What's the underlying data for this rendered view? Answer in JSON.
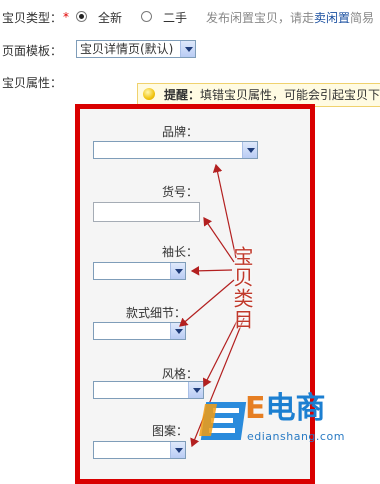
{
  "form": {
    "item_type": {
      "label": "宝贝类型：",
      "required_mark": "*",
      "options": [
        {
          "label": "全新",
          "checked": true
        },
        {
          "label": "二手",
          "checked": false
        }
      ],
      "hint_prefix": "发布闲置宝贝，请走",
      "hint_link": "卖闲置",
      "hint_suffix": "简易"
    },
    "page_template": {
      "label": "页面模板：",
      "selected": "宝贝详情页(默认)"
    },
    "attributes": {
      "label": "宝贝属性：",
      "notice_title": "提醒：",
      "notice_text": "填错宝贝属性，可能会引起宝贝下"
    }
  },
  "attribute_fields": [
    {
      "name": "brand",
      "label": "品牌：",
      "type": "select"
    },
    {
      "name": "sku",
      "label": "货号：",
      "type": "text"
    },
    {
      "name": "sleeve",
      "label": "袖长：",
      "type": "select"
    },
    {
      "name": "style-detail",
      "label": "款式细节：",
      "type": "select"
    },
    {
      "name": "style",
      "label": "风格：",
      "type": "select"
    },
    {
      "name": "pattern",
      "label": "图案：",
      "type": "select"
    }
  ],
  "annotation": {
    "text": "宝贝类目",
    "color": "#c0392b",
    "highlight_color": "#d90000"
  },
  "watermark": {
    "logo_letter": "E",
    "brand_text": "电商",
    "url": "edianshang.com"
  }
}
